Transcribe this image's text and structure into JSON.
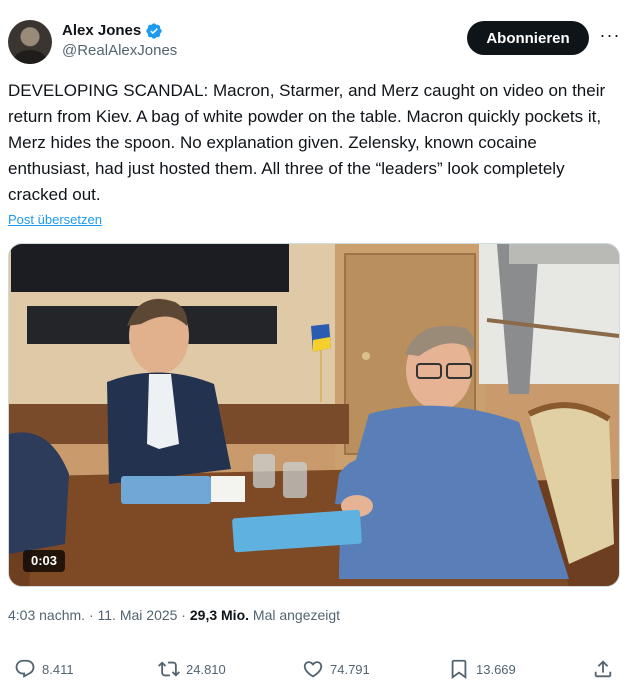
{
  "author": {
    "display_name": "Alex Jones",
    "handle": "@RealAlexJones"
  },
  "header": {
    "follow_label": "Abonnieren",
    "more_label": "···"
  },
  "tweet": {
    "text": "DEVELOPING SCANDAL: Macron, Starmer, and Merz caught on video on their return from Kiev. A bag of white powder on the table. Macron quickly pockets it, Merz hides the spoon. No explanation given. Zelensky, known cocaine enthusiast, had just hosted them. All three of the “leaders” look completely cracked out.",
    "translate_label": "Post übersetzen"
  },
  "media": {
    "duration": "0:03"
  },
  "meta": {
    "time": "4:03 nachm.",
    "separator": " · ",
    "date": "11. Mai 2025",
    "views_count": "29,3 Mio.",
    "views_label": "Mal angezeigt"
  },
  "actions": {
    "replies": "8.411",
    "reposts": "24.810",
    "likes": "74.791",
    "bookmarks": "13.669"
  },
  "colors": {
    "accent": "#1d9bf0",
    "text": "#0f1419",
    "muted": "#536471"
  }
}
